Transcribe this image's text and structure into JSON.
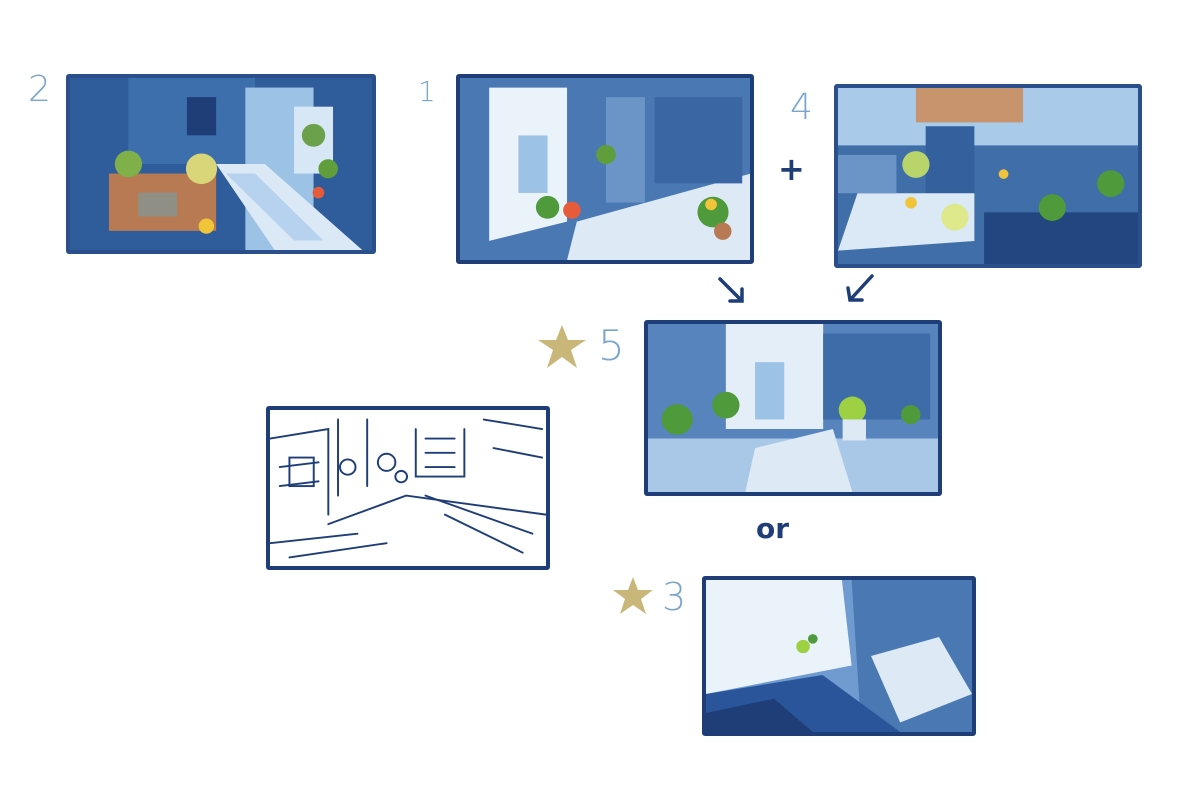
{
  "labels": {
    "t2": "2",
    "t1": "1",
    "t4": "4",
    "t5": "5",
    "t3": "3",
    "plus": "+",
    "or": "or"
  },
  "colors": {
    "ink": "#1f3e78",
    "mid_blue": "#4a78b2",
    "light_blue": "#9cc3e6",
    "pale": "#dde9f5",
    "number": "#7aa6cc",
    "star": "#c9b77a",
    "leaf": "#4f9a3a",
    "yellow": "#f0c53a",
    "terracotta": "#b77a52"
  },
  "icons": {
    "star": "star-icon",
    "arrow": "arrow-down-icon"
  }
}
